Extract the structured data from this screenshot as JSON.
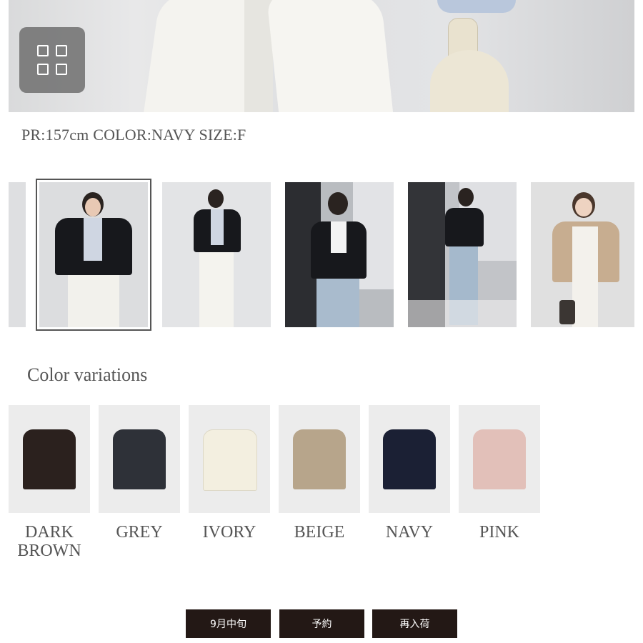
{
  "hero": {
    "grid_icon": "grid-view-icon"
  },
  "model_info": "PR:157cm COLOR:NAVY SIZE:F",
  "thumbnails": [
    {
      "name": "thumb-partial"
    },
    {
      "name": "thumb-1",
      "selected": true
    },
    {
      "name": "thumb-2"
    },
    {
      "name": "thumb-3"
    },
    {
      "name": "thumb-4"
    },
    {
      "name": "thumb-5"
    }
  ],
  "color_variations": {
    "title": "Color variations",
    "items": [
      {
        "label": "DARK BROWN",
        "color": "#2b211e"
      },
      {
        "label": "GREY",
        "color": "#2e3138"
      },
      {
        "label": "IVORY",
        "color": "#f3efe0"
      },
      {
        "label": "BEIGE",
        "color": "#b7a58b"
      },
      {
        "label": "NAVY",
        "color": "#1b2034"
      },
      {
        "label": "PINK",
        "color": "#e2c0b9"
      }
    ]
  },
  "buttons": {
    "mid_sep": "9月中旬",
    "reserve": "予約",
    "restock": "再入荷"
  }
}
